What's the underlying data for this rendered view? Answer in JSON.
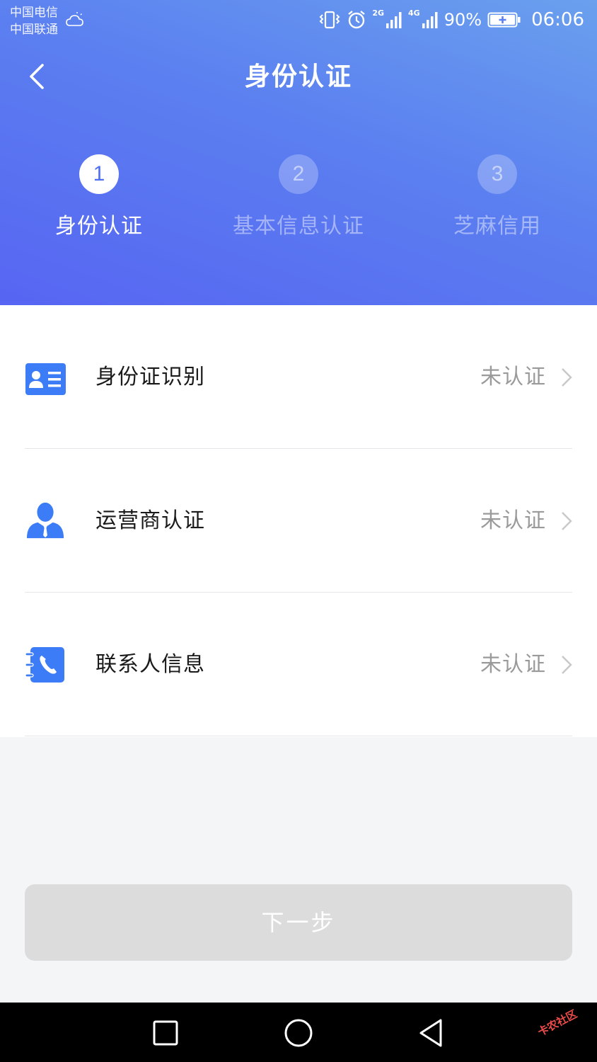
{
  "status_bar": {
    "carrier_1": "中国电信",
    "carrier_2": "中国联通",
    "net_1": "2G",
    "net_2": "4G",
    "battery": "90%",
    "time": "06:06",
    "icons": [
      "vibrate-icon",
      "alarm-icon",
      "signal-icon",
      "battery-charging-icon",
      "cloudy-weather-icon"
    ]
  },
  "header": {
    "title": "身份认证",
    "back_icon": "chevron-left-icon",
    "gradient_colors": [
      "#6aa0ee",
      "#5b7ff0",
      "#5765f2"
    ]
  },
  "steps": [
    {
      "number": "1",
      "label": "身份认证",
      "active": true
    },
    {
      "number": "2",
      "label": "基本信息认证",
      "active": false
    },
    {
      "number": "3",
      "label": "芝麻信用",
      "active": false
    }
  ],
  "items": [
    {
      "label": "身份证识别",
      "status": "未认证",
      "icon": "id-card-icon"
    },
    {
      "label": "运营商认证",
      "status": "未认证",
      "icon": "person-icon"
    },
    {
      "label": "联系人信息",
      "status": "未认证",
      "icon": "contacts-phone-icon"
    }
  ],
  "next_button": {
    "label": "下一步",
    "enabled": false
  },
  "nav_bar": {
    "icons": [
      "square-recent-icon",
      "circle-home-icon",
      "triangle-back-icon"
    ]
  },
  "watermark": {
    "text": "卡农社区"
  },
  "colors": {
    "accent": "#4f7cf0",
    "icon_blue": "#3c7cf6",
    "status_gray": "#9a9a9a",
    "button_disabled": "#dcdcdc",
    "page_bg": "#f4f5f7"
  }
}
